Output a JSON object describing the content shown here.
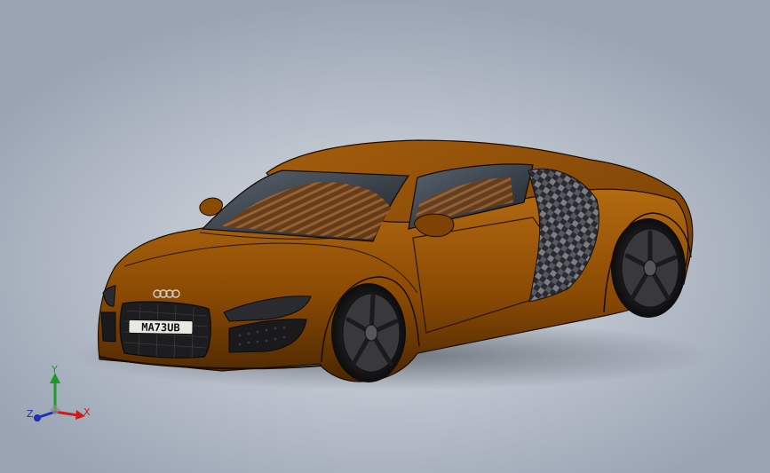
{
  "viewport": {
    "background_top": "#c9cfd8",
    "background_bottom": "#9aa4b3"
  },
  "model": {
    "name_icon": "car-model",
    "body_color": "#8a4a04",
    "body_highlight": "#b36a10",
    "body_shadow": "#4a2602",
    "license_plate": "MA73UB",
    "carbon_sideblade_color": "#2a2a30",
    "wheel_color": "#2b2b2f"
  },
  "triad": {
    "x_label": "X",
    "y_label": "Y",
    "z_label": "Z",
    "x_color": "#d11b1b",
    "y_color": "#1f9a2a",
    "z_color": "#1d2fb8"
  }
}
